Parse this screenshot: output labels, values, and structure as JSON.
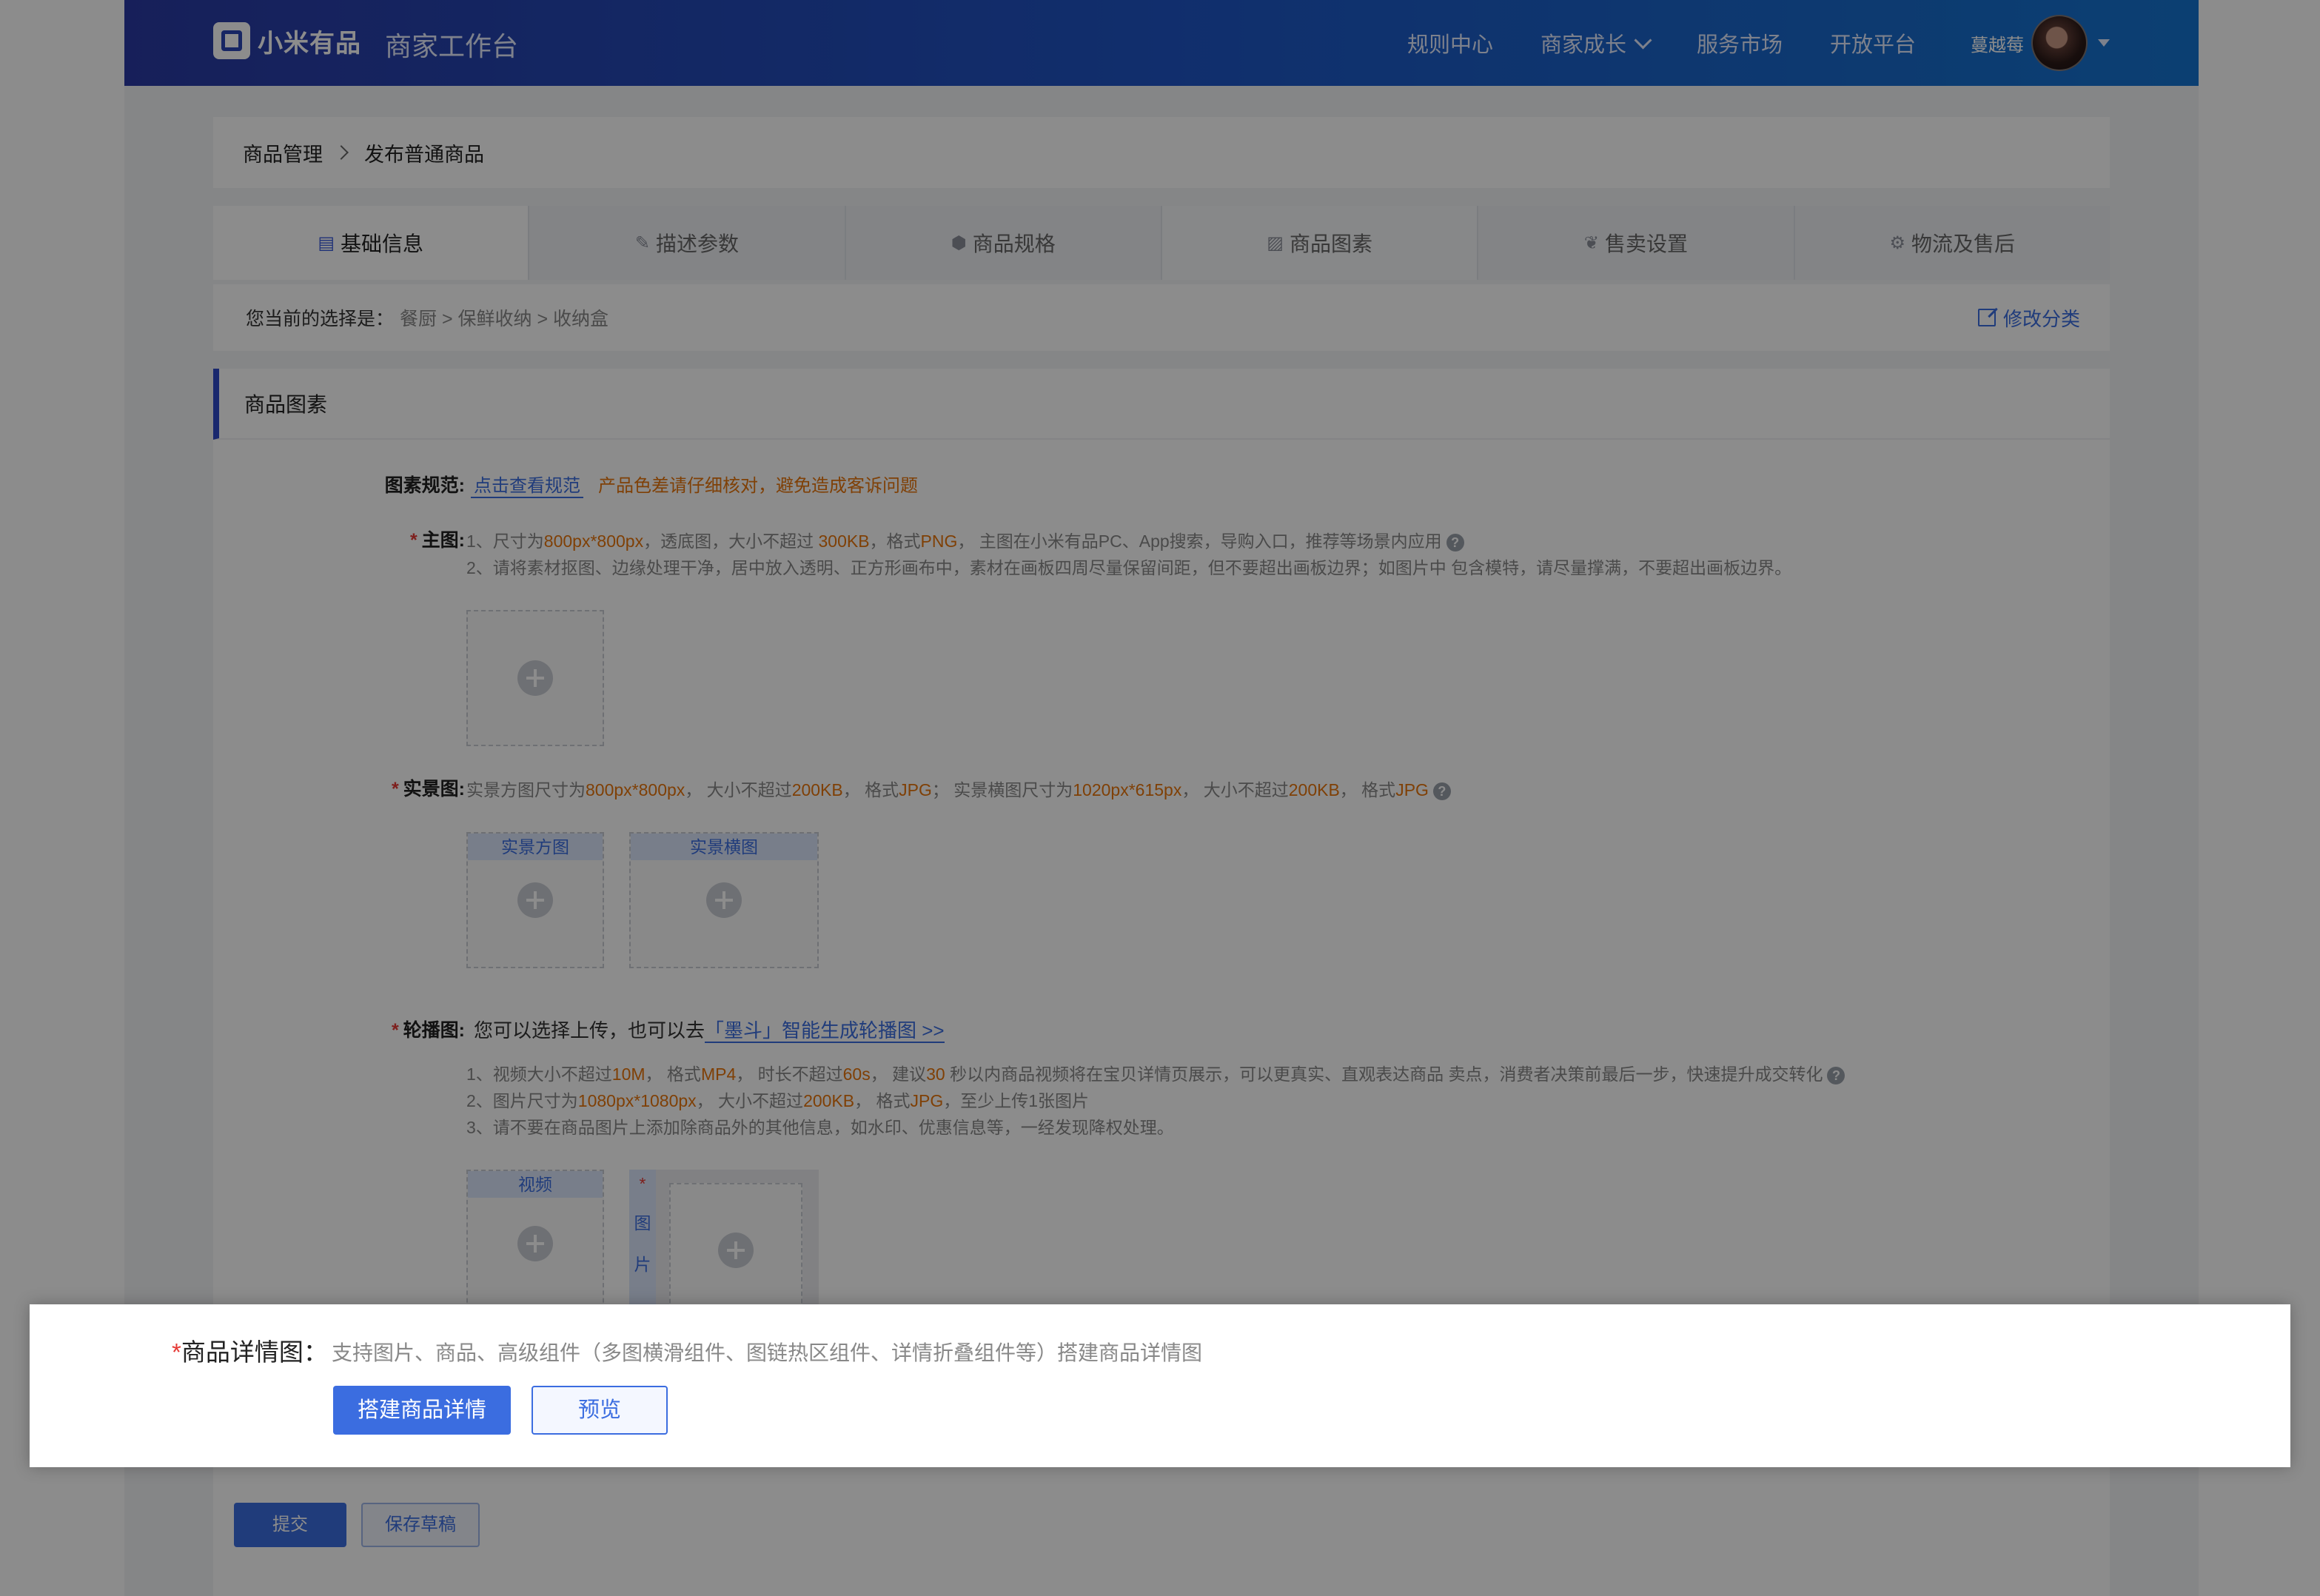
{
  "header": {
    "logo_text": "小米有品",
    "workbench_title": "商家工作台",
    "nav": [
      "规则中心",
      "商家成长",
      "服务市场",
      "开放平台"
    ],
    "user_name": "蔓越莓"
  },
  "breadcrumb": {
    "parent": "商品管理",
    "current": "发布普通商品"
  },
  "tabs": [
    {
      "label": "基础信息",
      "icon": "document-icon"
    },
    {
      "label": "描述参数",
      "icon": "pen-icon"
    },
    {
      "label": "商品规格",
      "icon": "hexagon-icon"
    },
    {
      "label": "商品图素",
      "icon": "image-icon"
    },
    {
      "label": "售卖设置",
      "icon": "badge-icon"
    },
    {
      "label": "物流及售后",
      "icon": "gear-icon"
    }
  ],
  "selection": {
    "label": "您当前的选择是：",
    "path": "餐厨 > 保鲜收纳 > 收纳盒",
    "modify": "修改分类"
  },
  "section": {
    "title": "商品图素"
  },
  "spec": {
    "label": "图素规范:",
    "link": "点击查看规范",
    "warning": "产品色差请仔细核对，避免造成客诉问题"
  },
  "main_image": {
    "label": "主图:",
    "line1": {
      "a": "1、尺寸为",
      "b": "800px*800px",
      "c": "，透底图，大小不超过 ",
      "d": "300KB",
      "e": "，格式",
      "f": "PNG",
      "g": "， 主图在小米有品PC、App搜索，导购入口，推荐等场景内应用"
    },
    "line2": "2、请将素材抠图、边缘处理干净，居中放入透明、正方形画布中，素材在画板四周尽量保留间距，但不要超出画板边界；如图片中 包含模特，请尽量撑满，不要超出画板边界。"
  },
  "scene_image": {
    "label": "实景图:",
    "note": {
      "a": "实景方图尺寸为",
      "b": "800px*800px",
      "c": "， 大小不超过",
      "d": "200KB",
      "e": "， 格式",
      "f": "JPG",
      "g": "； 实景横图尺寸为",
      "h": "1020px*615px",
      "i": "， 大小不超过",
      "j": "200KB",
      "k": "， 格式",
      "l": "JPG"
    },
    "square": "实景方图",
    "landscape": "实景横图"
  },
  "carousel": {
    "label": "轮播图:",
    "tip": "您可以选择上传，也可以去",
    "link": "「墨斗」智能生成轮播图 >>",
    "line1": {
      "a": "1、视频大小不超过",
      "b": "10M",
      "c": "， 格式",
      "d": "MP4",
      "e": "， 时长不超过",
      "f": "60s",
      "g": "， 建议",
      "h": "30",
      "i": " 秒以内商品视频将在宝贝详情页展示，可以更真实、直观表达商品 卖点，消费者决策前最后一步，快速提升成交转化"
    },
    "line2": {
      "a": "2、图片尺寸为",
      "b": "1080px*1080px",
      "c": "， 大小不超过",
      "d": "200KB",
      "e": "， 格式",
      "f": "JPG",
      "g": "，至少上传1张图片"
    },
    "line3": "3、请不要在商品图片上添加除商品外的其他信息，如水印、优惠信息等，一经发现降权处理。",
    "video": "视频",
    "image_star": "*",
    "image_chars": [
      "图",
      "片"
    ]
  },
  "footer": {
    "submit": "提交",
    "draft": "保存草稿"
  },
  "detail_panel": {
    "star": "*",
    "label": "商品详情图：",
    "desc": "支持图片、商品、高级组件（多图横滑组件、图链热区组件、详情折叠组件等）搭建商品详情图",
    "build": "搭建商品详情",
    "preview": "预览"
  },
  "help_glyph": "?",
  "colors": {
    "primary": "#3b6de0",
    "warning": "#e8750c",
    "required": "#e53935",
    "header_start": "#2a3aa4",
    "header_end": "#1574d0"
  }
}
